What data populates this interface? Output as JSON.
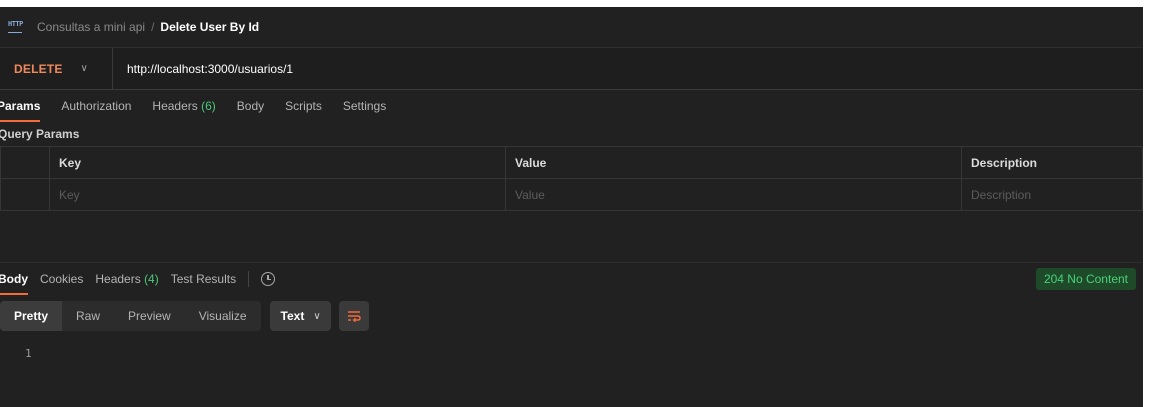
{
  "breadcrumb": {
    "icon": "http-icon",
    "parent": "Consultas a mini api",
    "separator": "/",
    "current": "Delete User By Id"
  },
  "request": {
    "method": "DELETE",
    "method_color": "#f08a5d",
    "url": "http://localhost:3000/usuarios/1"
  },
  "request_tabs": [
    {
      "label": "Params",
      "active": true
    },
    {
      "label": "Authorization"
    },
    {
      "label": "Headers",
      "count": "(6)"
    },
    {
      "label": "Body"
    },
    {
      "label": "Scripts"
    },
    {
      "label": "Settings"
    }
  ],
  "query_params": {
    "title": "Query Params",
    "columns": [
      "Key",
      "Value",
      "Description"
    ],
    "placeholders": [
      "Key",
      "Value",
      "Description"
    ]
  },
  "response_tabs": [
    {
      "label": "Body",
      "active": true
    },
    {
      "label": "Cookies"
    },
    {
      "label": "Headers",
      "count": "(4)"
    },
    {
      "label": "Test Results"
    }
  ],
  "status": {
    "text": "204 No Content",
    "color": "#49d17a"
  },
  "format_tabs": [
    "Pretty",
    "Raw",
    "Preview",
    "Visualize"
  ],
  "body_type": "Text",
  "line_numbers": [
    "1"
  ],
  "accent_color": "#f26b3a"
}
